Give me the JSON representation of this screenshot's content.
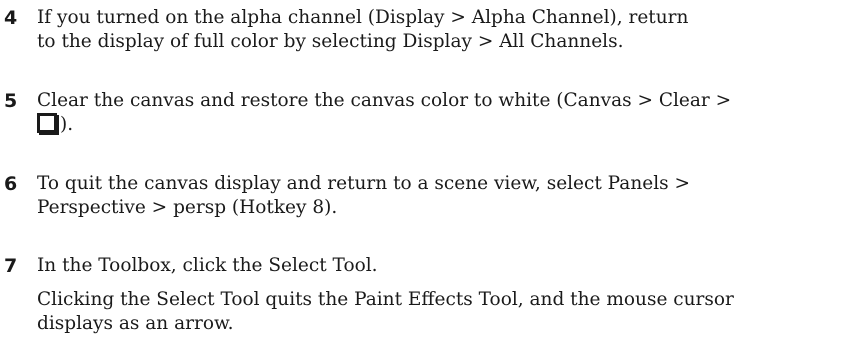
{
  "steps": [
    {
      "number": "4",
      "lines": [
        "If you turned on the alpha channel (Display > Alpha Channel), return",
        "to the display of full color by selecting Display > All Channels."
      ]
    },
    {
      "number": "5",
      "lines": [
        "Clear the canvas and restore the canvas color to white (Canvas > Clear >"
      ],
      "icon": "clear-canvas-options-box-icon",
      "after_icon": ")."
    },
    {
      "number": "6",
      "lines": [
        "To quit the canvas display and return to a scene view, select Panels >",
        "Perspective > persp (Hotkey 8)."
      ]
    },
    {
      "number": "7",
      "lines": [
        "In the Toolbox, click the Select Tool."
      ],
      "note_lines": [
        "Clicking the Select Tool quits the Paint Effects Tool, and the mouse cursor",
        "displays as an arrow."
      ]
    }
  ]
}
